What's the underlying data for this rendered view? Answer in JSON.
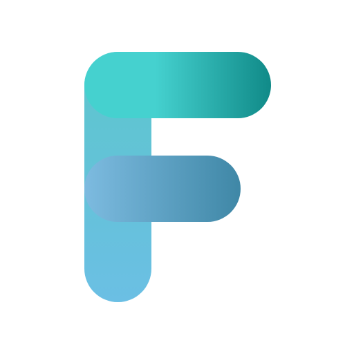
{
  "logo": {
    "name": "F letter logo",
    "colors": {
      "stem_top": "#5cc6cc",
      "stem_bottom": "#6bbfe4",
      "top_bar_left": "#45d1cf",
      "top_bar_right": "#108a88",
      "middle_bar_left": "#7dbbe0",
      "middle_bar_right": "#3f87a6"
    }
  }
}
